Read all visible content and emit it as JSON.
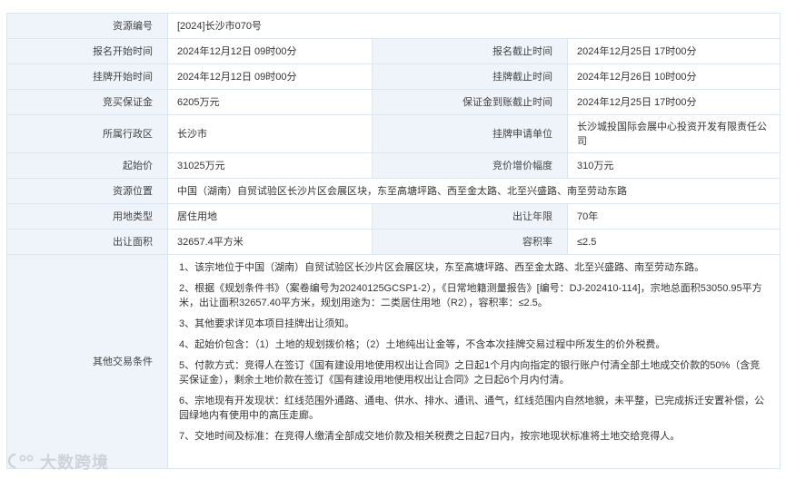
{
  "rows": {
    "parcel_id": {
      "label": "资源编号",
      "value": "[2024]长沙市070号"
    },
    "apply_time": {
      "label1": "报名开始时间",
      "value1": "2024年12月12日 09时00分",
      "label2": "报名截止时间",
      "value2": "2024年12月25日 17时00分"
    },
    "listing_time": {
      "label1": "挂牌开始时间",
      "value1": "2024年12月12日 09时00分",
      "label2": "挂牌截止时间",
      "value2": "2024年12月26日 10时00分"
    },
    "deposit": {
      "label1": "竞买保证金",
      "value1": "6205万元",
      "label2": "保证金到账截止时间",
      "value2": "2024年12月25日 17时00分"
    },
    "district": {
      "label1": "所属行政区",
      "value1": "长沙市",
      "label2": "挂牌申请单位",
      "value2": "长沙城投国际会展中心投资开发有限责任公司"
    },
    "price": {
      "label1": "起始价",
      "value1": "31025万元",
      "label2": "竞价增价幅度",
      "value2": "310万元"
    },
    "location": {
      "label": "资源位置",
      "value": "中国（湖南）自贸试验区长沙片区会展区块，东至高塘坪路、西至金太路、北至兴盛路、南至劳动东路"
    },
    "use": {
      "label1": "用地类型",
      "value1": "居住用地",
      "label2": "出让年限",
      "value2": "70年"
    },
    "area": {
      "label1": "出让面积",
      "value1": "32657.4平方米",
      "label2": "容积率",
      "value2": "≤2.5"
    },
    "other": {
      "label": "其他交易条件",
      "notes": [
        "1、该宗地位于中国（湖南）自贸试验区长沙片区会展区块，东至高塘坪路、西至金太路、北至兴盛路、南至劳动东路。",
        "2、根据《规划条件书》（案卷编号为20240125GCSP1-2），《日常地籍测量报告》[编号：DJ-202410-114]，宗地总面积53050.95平方米，出让面积32657.40平方米，规划用途为：二类居住用地（R2），容积率：≤2.5。",
        "3、其他要求详见本项目挂牌出让须知。",
        "4、起始价包含：（1）土地的规划拨价格；（2）土地纯出让金等，不含本次挂牌交易过程中所发生的价外税费。",
        "5、付款方式：竞得人在签订《国有建设用地使用权出让合同》之日起1个月内向指定的银行账户付清全部土地成交价款的50%（含竞买保证金），剩余土地价款在签订《国有建设用地使用权出让合同》之日起6个月内付清。",
        "6、宗地现有开发现状：红线范围外通路、通电、供水、排水、通讯、通气，红线范围内自然地貌，未平整，已完成拆迁安置补偿，公园绿地内有使用中的高压走廊。",
        "7、交地时间及标准：在竞得人缴清全部成交地价款及相关税费之日起7日内，按宗地现状标准将土地交给竞得人。"
      ]
    }
  },
  "watermark": {
    "text": "大数跨境",
    "icon": "brand-logo-icon"
  },
  "colors": {
    "label_bg": "#eef4fa",
    "border": "#dde5ee",
    "text": "#333333"
  }
}
